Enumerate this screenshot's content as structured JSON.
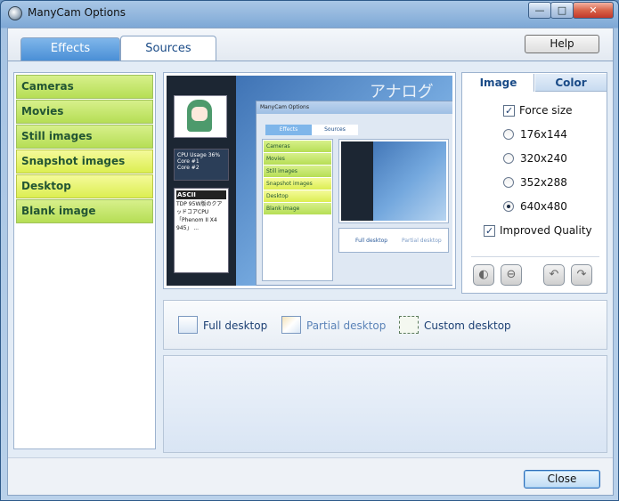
{
  "window": {
    "title": "ManyCam Options",
    "controls": {
      "minimize": "—",
      "maximize": "□",
      "close": "✕"
    }
  },
  "tabs": [
    {
      "label": "Effects",
      "active": false
    },
    {
      "label": "Sources",
      "active": true
    }
  ],
  "help_label": "Help",
  "sources": [
    {
      "label": "Cameras",
      "selected": false
    },
    {
      "label": "Movies",
      "selected": false
    },
    {
      "label": "Still images",
      "selected": false
    },
    {
      "label": "Snapshot images",
      "selected": true
    },
    {
      "label": "Desktop",
      "selected": true
    },
    {
      "label": "Blank image",
      "selected": false
    }
  ],
  "preview": {
    "overlay_text": "アナログ",
    "cpu_label": "CPU Usage",
    "cpu_value": "36%",
    "core1": "Core #1",
    "core2": "Core #2",
    "news_head": "ASCII",
    "news_text": "TDP 95W版のクアッドコアCPU「Phenom II X4 945」 ...",
    "nested": {
      "title": "ManyCam Options",
      "tab1": "Effects",
      "tab2": "Sources",
      "items": [
        "Cameras",
        "Movies",
        "Still images",
        "Snapshot images",
        "Desktop",
        "Blank image"
      ],
      "mode1": "Full desktop",
      "mode2": "Partial desktop"
    }
  },
  "options": {
    "tab_image": "Image",
    "tab_color": "Color",
    "force_size_label": "Force size",
    "force_size_checked": true,
    "sizes": [
      {
        "label": "176x144",
        "selected": false
      },
      {
        "label": "320x240",
        "selected": false
      },
      {
        "label": "352x288",
        "selected": false
      },
      {
        "label": "640x480",
        "selected": true
      }
    ],
    "improved_quality_label": "Improved Quality",
    "improved_quality_checked": true,
    "tools": [
      {
        "icon": "flip-horizontal-icon",
        "glyph": "◐"
      },
      {
        "icon": "flip-vertical-icon",
        "glyph": "⊖"
      },
      {
        "icon": "rotate-left-icon",
        "glyph": "↶"
      },
      {
        "icon": "rotate-right-icon",
        "glyph": "↷"
      }
    ]
  },
  "modes": [
    {
      "label": "Full desktop"
    },
    {
      "label": "Partial desktop"
    },
    {
      "label": "Custom desktop"
    }
  ],
  "close_label": "Close"
}
